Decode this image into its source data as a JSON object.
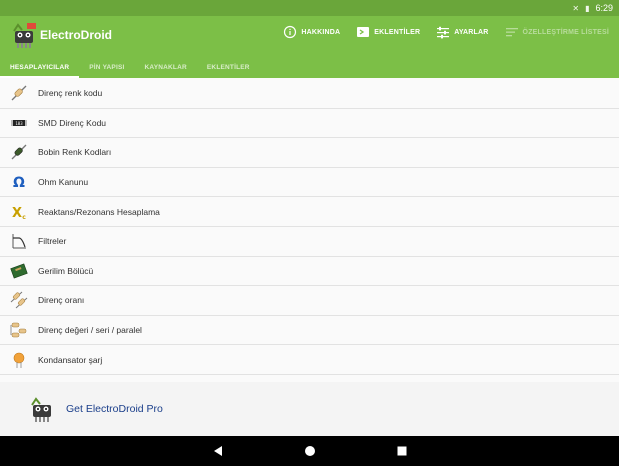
{
  "status_bar": {
    "time": "6:29"
  },
  "app_bar": {
    "title": "ElectroDroid",
    "actions": [
      {
        "label": "HAKKINDA",
        "icon": "info-icon"
      },
      {
        "label": "EKLENTİLER",
        "icon": "plugin-icon"
      },
      {
        "label": "AYARLAR",
        "icon": "settings-icon"
      },
      {
        "label": "ÖZELLEŞTİRME LİSTESİ",
        "icon": "sort-icon"
      }
    ]
  },
  "tabs": [
    {
      "label": "HESAPLAYICILAR",
      "active": true
    },
    {
      "label": "PİN YAPISI",
      "active": false
    },
    {
      "label": "KAYNAKLAR",
      "active": false
    },
    {
      "label": "EKLENTİLER",
      "active": false
    }
  ],
  "calculators": [
    {
      "label": "Direnç renk kodu",
      "icon": "resistor-icon"
    },
    {
      "label": "SMD Direnç Kodu",
      "icon": "smd-resistor-icon"
    },
    {
      "label": "Bobin Renk Kodları",
      "icon": "inductor-icon"
    },
    {
      "label": "Ohm Kanunu",
      "icon": "ohm-icon"
    },
    {
      "label": "Reaktans/Rezonans Hesaplama",
      "icon": "reactance-icon"
    },
    {
      "label": "Filtreler",
      "icon": "filter-icon"
    },
    {
      "label": "Gerilim Bölücü",
      "icon": "voltage-divider-icon"
    },
    {
      "label": "Direnç oranı",
      "icon": "resistor-ratio-icon"
    },
    {
      "label": "Direnç değeri / seri / paralel",
      "icon": "series-parallel-icon"
    },
    {
      "label": "Kondansator şarj",
      "icon": "capacitor-icon"
    }
  ],
  "promo": {
    "text": "Get ElectroDroid Pro"
  },
  "colors": {
    "primary": "#7cbf47",
    "status": "#6aa63a",
    "promo_text": "#1a3e8a"
  }
}
